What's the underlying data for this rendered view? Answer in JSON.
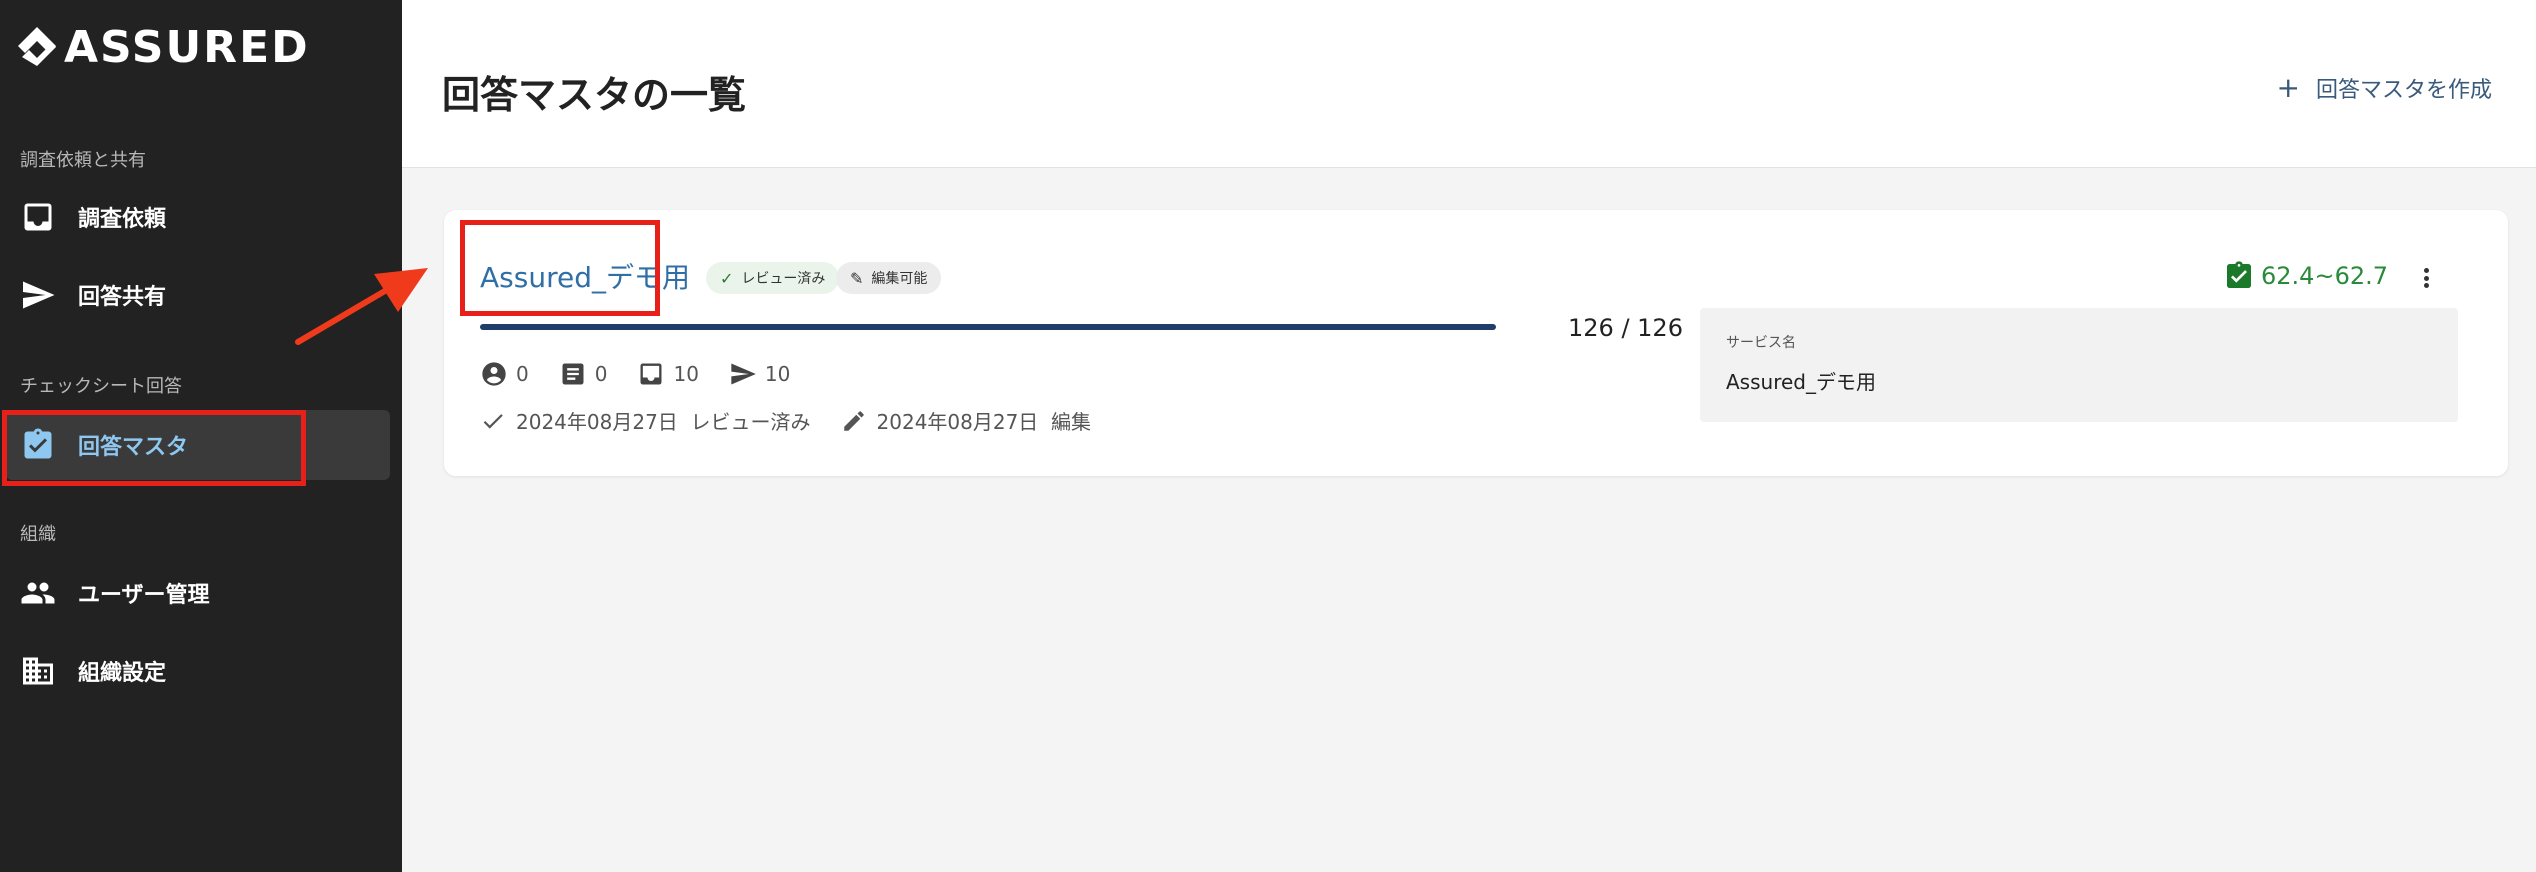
{
  "app": {
    "logo_text": "ASSURED"
  },
  "sidebar": {
    "sections": [
      {
        "label": "調査依頼と共有"
      },
      {
        "label": "チェックシート回答"
      },
      {
        "label": "組織"
      }
    ],
    "items": [
      {
        "label": "調査依頼",
        "icon": "inbox-icon"
      },
      {
        "label": "回答共有",
        "icon": "send-icon"
      },
      {
        "label": "回答マスタ",
        "icon": "clipboard-check-icon",
        "active": true
      },
      {
        "label": "ユーザー管理",
        "icon": "users-icon"
      },
      {
        "label": "組織設定",
        "icon": "building-icon"
      }
    ]
  },
  "header": {
    "title": "回答マスタの一覧",
    "create_label": "回答マスタを作成"
  },
  "card": {
    "title": "Assured_デモ用",
    "badges": [
      {
        "label": "レビュー済み"
      },
      {
        "label": "編集可能"
      }
    ],
    "progress": {
      "done": 126,
      "total": 126,
      "text": "126 / 126",
      "fraction": 1.0
    },
    "stats": [
      {
        "icon": "account-circle-icon",
        "value": "0"
      },
      {
        "icon": "document-icon",
        "value": "0"
      },
      {
        "icon": "inbox-icon",
        "value": "10"
      },
      {
        "icon": "send-icon",
        "value": "10"
      }
    ],
    "dates": [
      {
        "icon": "check-icon",
        "text": "2024年08月27日  レビュー済み"
      },
      {
        "icon": "pencil-icon",
        "text": "2024年08月27日  編集"
      }
    ],
    "score": "62.4~62.7",
    "service": {
      "label": "サービス名",
      "value": "Assured_デモ用"
    }
  },
  "colors": {
    "sidebar_bg": "#222222",
    "accent": "#2f6fa6",
    "highlight": "#e8201a",
    "score": "#2a8a3a"
  }
}
